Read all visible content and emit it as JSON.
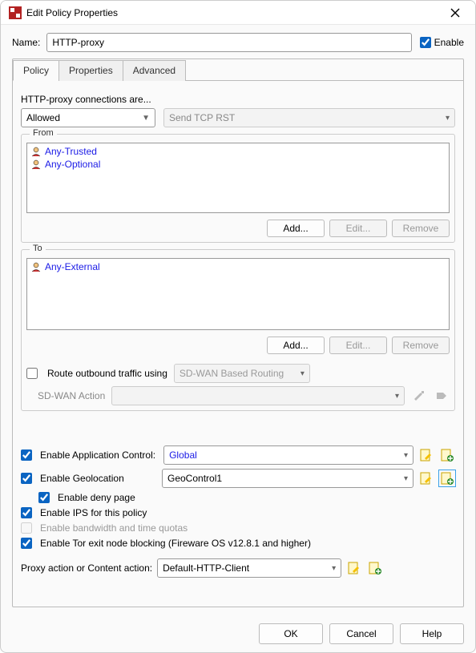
{
  "window": {
    "title": "Edit Policy Properties"
  },
  "header": {
    "name_label": "Name:",
    "name_value": "HTTP-proxy",
    "enable_label": "Enable",
    "enable_checked": true
  },
  "tabs": {
    "items": [
      "Policy",
      "Properties",
      "Advanced"
    ],
    "active": 0
  },
  "policy_tab": {
    "connections_label": "HTTP-proxy connections are...",
    "connection_mode": "Allowed",
    "deny_action": "Send TCP RST",
    "from": {
      "legend": "From",
      "items": [
        "Any-Trusted",
        "Any-Optional"
      ],
      "add": "Add...",
      "edit": "Edit...",
      "remove": "Remove"
    },
    "to": {
      "legend": "To",
      "items": [
        "Any-External"
      ],
      "add": "Add...",
      "edit": "Edit...",
      "remove": "Remove"
    },
    "route_outbound": {
      "label": "Route outbound traffic using",
      "value": "SD-WAN Based Routing",
      "checked": false
    },
    "sdwan_action": {
      "label": "SD-WAN Action",
      "value": ""
    },
    "app_control": {
      "label": "Enable Application Control:",
      "checked": true,
      "value": "Global"
    },
    "geolocation": {
      "label": "Enable Geolocation",
      "checked": true,
      "value": "GeoControl1"
    },
    "deny_page": {
      "label": "Enable deny page",
      "checked": true
    },
    "ips": {
      "label": "Enable IPS for this policy",
      "checked": true
    },
    "bandwidth": {
      "label": "Enable bandwidth and time quotas",
      "checked": false
    },
    "tor": {
      "label": "Enable Tor exit node blocking (Fireware OS v12.8.1 and higher)",
      "checked": true
    },
    "proxy_action": {
      "label": "Proxy action or Content action:",
      "value": "Default-HTTP-Client"
    }
  },
  "footer": {
    "ok": "OK",
    "cancel": "Cancel",
    "help": "Help"
  }
}
